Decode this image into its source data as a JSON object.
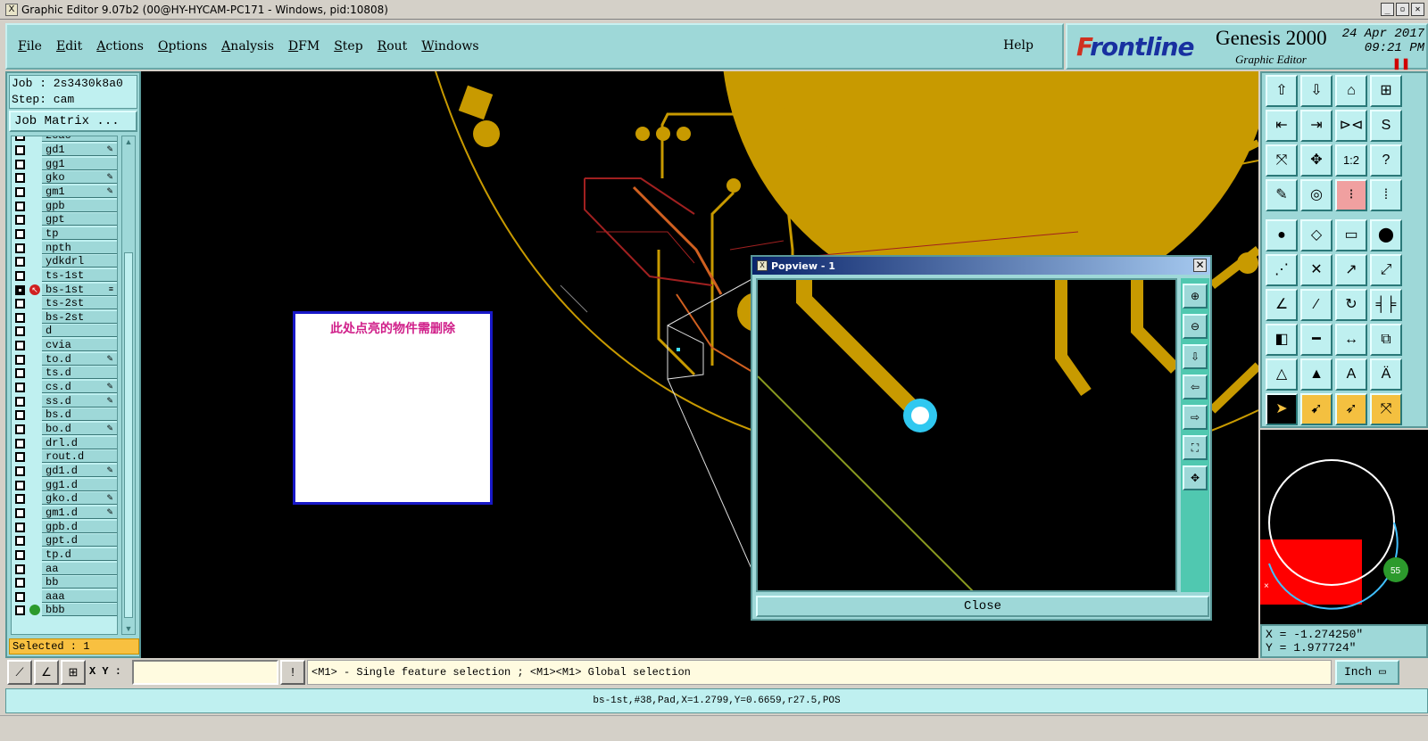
{
  "window": {
    "title": "Graphic Editor 9.07b2 (00@HY-HYCAM-PC171 - Windows, pid:10808)",
    "app_icon": "X"
  },
  "menu": {
    "items": [
      "File",
      "Edit",
      "Actions",
      "Options",
      "Analysis",
      "DFM",
      "Step",
      "Rout",
      "Windows"
    ],
    "help": "Help"
  },
  "brand": {
    "logo_f": "F",
    "logo_rest": "rontline",
    "product": "Genesis 2000",
    "subtitle": "Graphic Editor",
    "date": "24 Apr 2017",
    "time": "09:21 PM"
  },
  "job": {
    "job_line": "Job : 2s3430k8a0",
    "step_line": "Step: cam",
    "matrix_button": "Job Matrix ...",
    "top_partial": "zoao"
  },
  "layers": [
    {
      "name": "gd1",
      "tag": "✎"
    },
    {
      "name": "gg1",
      "tag": ""
    },
    {
      "name": "gko",
      "tag": "✎"
    },
    {
      "name": "gm1",
      "tag": "✎"
    },
    {
      "name": "gpb",
      "tag": ""
    },
    {
      "name": "gpt",
      "tag": ""
    },
    {
      "name": "tp",
      "tag": ""
    },
    {
      "name": "npth",
      "tag": ""
    },
    {
      "name": "ydkdrl",
      "tag": ""
    },
    {
      "name": "ts-1st",
      "tag": ""
    },
    {
      "name": "bs-1st",
      "tag": "≡",
      "active": true
    },
    {
      "name": "ts-2st",
      "tag": ""
    },
    {
      "name": "bs-2st",
      "tag": ""
    },
    {
      "name": "d",
      "tag": ""
    },
    {
      "name": "cvia",
      "tag": ""
    },
    {
      "name": "to.d",
      "tag": "✎"
    },
    {
      "name": "ts.d",
      "tag": ""
    },
    {
      "name": "cs.d",
      "tag": "✎"
    },
    {
      "name": "ss.d",
      "tag": "✎"
    },
    {
      "name": "bs.d",
      "tag": ""
    },
    {
      "name": "bo.d",
      "tag": "✎"
    },
    {
      "name": "drl.d",
      "tag": ""
    },
    {
      "name": "rout.d",
      "tag": ""
    },
    {
      "name": "gd1.d",
      "tag": "✎"
    },
    {
      "name": "gg1.d",
      "tag": ""
    },
    {
      "name": "gko.d",
      "tag": "✎"
    },
    {
      "name": "gm1.d",
      "tag": "✎"
    },
    {
      "name": "gpb.d",
      "tag": ""
    },
    {
      "name": "gpt.d",
      "tag": ""
    },
    {
      "name": "tp.d",
      "tag": ""
    },
    {
      "name": "aa",
      "tag": ""
    },
    {
      "name": "bb",
      "tag": ""
    },
    {
      "name": "aaa",
      "tag": ""
    },
    {
      "name": "bbb",
      "tag": "",
      "green": true
    }
  ],
  "selected_label": "Selected : 1",
  "annotation": "此处点亮的物件需删除",
  "popview": {
    "title": "Popview - 1",
    "close_label": "Close"
  },
  "coords": {
    "x": "X = -1.274250\"",
    "y": "Y = 1.977724\""
  },
  "minimap_badge": "55",
  "cmd": {
    "xy_label": "X Y :",
    "xy_value": "",
    "hint": "<M1> - Single feature selection ; <M1><M1> Global selection",
    "units": "Inch"
  },
  "status": "bs-1st,#38,Pad,X=1.2799,Y=0.6659,r27.5,POS",
  "colors": {
    "copper": "#c89a00",
    "panel": "#9ed8d8",
    "canvas": "#000000",
    "annot_text": "#d0208a"
  }
}
